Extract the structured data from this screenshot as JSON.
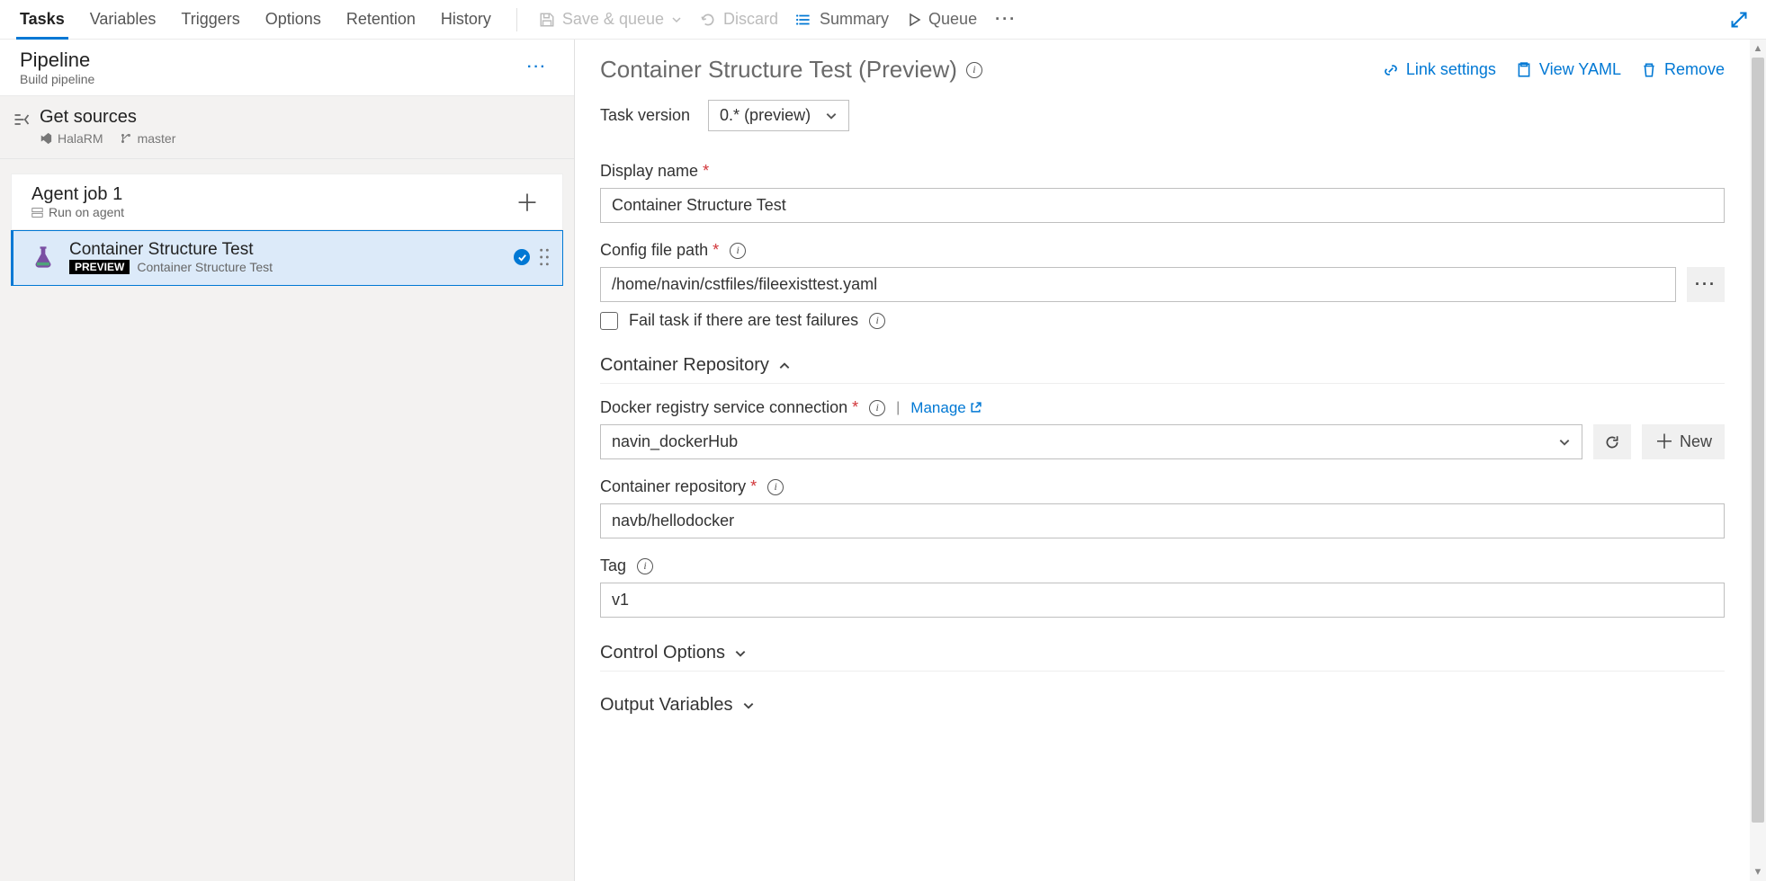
{
  "toolbar": {
    "tabs": [
      "Tasks",
      "Variables",
      "Triggers",
      "Options",
      "Retention",
      "History"
    ],
    "active_tab_index": 0,
    "save_queue": "Save & queue",
    "discard": "Discard",
    "summary": "Summary",
    "queue": "Queue"
  },
  "left": {
    "pipeline_title": "Pipeline",
    "pipeline_subtitle": "Build pipeline",
    "get_sources_title": "Get sources",
    "get_sources_repo": "HalaRM",
    "get_sources_branch": "master",
    "agent_job_title": "Agent job 1",
    "agent_job_subtitle": "Run on agent",
    "task": {
      "title": "Container Structure Test",
      "badge": "PREVIEW",
      "subtitle": "Container Structure Test"
    }
  },
  "right": {
    "title": "Container Structure Test (Preview)",
    "actions": {
      "link_settings": "Link settings",
      "view_yaml": "View YAML",
      "remove": "Remove"
    },
    "task_version_label": "Task version",
    "task_version_value": "0.* (preview)",
    "display_name_label": "Display name",
    "display_name_value": "Container Structure Test",
    "config_path_label": "Config file path",
    "config_path_value": "/home/navin/cstfiles/fileexisttest.yaml",
    "fail_checkbox_label": "Fail task if there are test failures",
    "section_container_repo": "Container Repository",
    "docker_conn_label": "Docker registry service connection",
    "manage_label": "Manage",
    "docker_conn_value": "navin_dockerHub",
    "new_label": "New",
    "container_repo_label": "Container repository",
    "container_repo_value": "navb/hellodocker",
    "tag_label": "Tag",
    "tag_value": "v1",
    "section_control_options": "Control Options",
    "section_output_vars": "Output Variables"
  }
}
